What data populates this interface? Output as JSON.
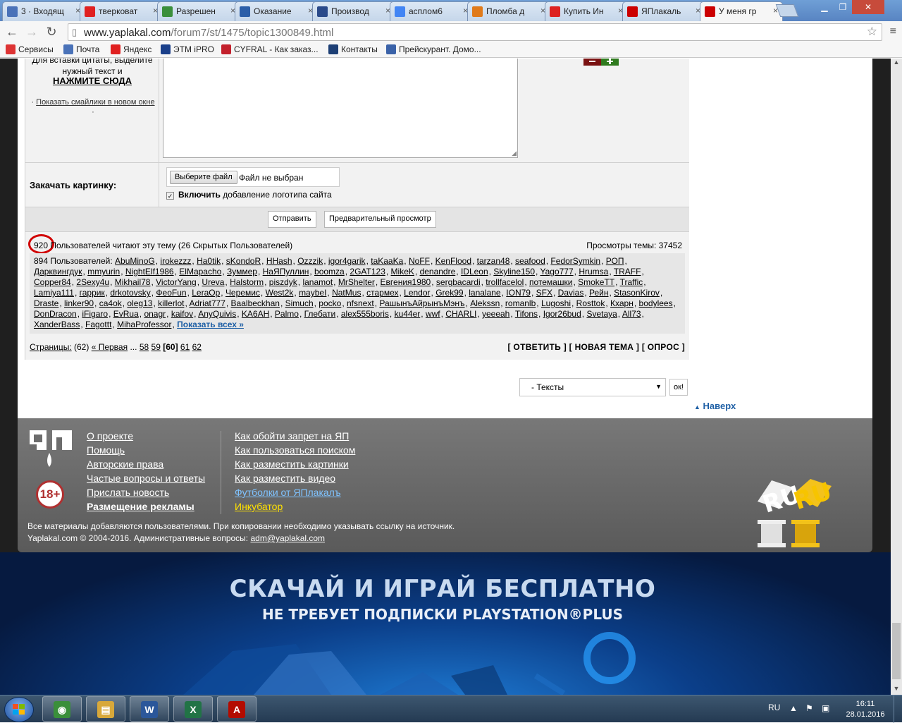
{
  "browser": {
    "tabs": [
      {
        "label": "3 · Входящ",
        "icon": "mail-icon",
        "color": "#4a72b8"
      },
      {
        "label": "тверковат",
        "icon": "yandex-icon",
        "color": "#e02020"
      },
      {
        "label": "Разрешен",
        "icon": "globe-icon",
        "color": "#3b8f3b"
      },
      {
        "label": "Оказание",
        "icon": "pin-icon",
        "color": "#2b5ea8"
      },
      {
        "label": "Производ",
        "icon": "site-icon",
        "color": "#2a4a8a"
      },
      {
        "label": "асплом6",
        "icon": "google-icon",
        "color": "#4285f4"
      },
      {
        "label": "Пломба д",
        "icon": "site-icon",
        "color": "#e07a1a"
      },
      {
        "label": "Купить Ин",
        "icon": "site-icon",
        "color": "#d22"
      },
      {
        "label": "ЯПлакаль",
        "icon": "yp-icon",
        "color": "#c00"
      },
      {
        "label": "У меня гр",
        "icon": "yp-icon",
        "color": "#c00",
        "active": true
      }
    ],
    "url_host": "www.yaplakal.com",
    "url_path": "/forum7/st/1475/topic1300849.html",
    "bookmarks": [
      {
        "label": "Сервисы",
        "icon": "apps-icon",
        "color": "#d33"
      },
      {
        "label": "Почта",
        "icon": "mail-icon",
        "color": "#4a72b8"
      },
      {
        "label": "Яндекс",
        "icon": "yandex-icon",
        "color": "#e02020"
      },
      {
        "label": "ЭТМ iPRO",
        "icon": "etm-icon",
        "color": "#1a3f8a"
      },
      {
        "label": "CYFRAL - Как заказ...",
        "icon": "cyfral-icon",
        "color": "#c3202c"
      },
      {
        "label": "Контакты",
        "icon": "contacts-icon",
        "color": "#1d3f75"
      },
      {
        "label": "Прейскурант. Домо...",
        "icon": "flag-icon",
        "color": "#3a62a8"
      }
    ]
  },
  "form": {
    "quote_hint": "Для вставки цитаты, выделите нужный текст и",
    "quote_click": "НАЖМИТЕ СЮДА",
    "smilies_link": "Показать смайлики в новом окне",
    "upload_label": "Закачать картинку:",
    "file_button": "Выберите файл",
    "file_status": "Файл не выбран",
    "logo_bold": "Включить",
    "logo_rest": "добавление логотипа сайта",
    "submit": "Отправить",
    "preview": "Предварительный просмотр"
  },
  "readers": {
    "count": "920",
    "text": "Пользователей читают эту тему (26 Скрытых Пользователей)",
    "views": "Просмотры темы: 37452",
    "users_prefix": "894 Пользователей:",
    "users": [
      "AbuMinoG",
      "irokezzz",
      "Ha0tik",
      "sKondoR",
      "HHash",
      "Ozzzik",
      "igor4garik",
      "taKaaKa",
      "NoFF",
      "KenFlood",
      "tarzan48",
      "seafood",
      "FedorSymkin",
      "РОП",
      "Дарквингдук",
      "mmyurin",
      "NightElf1986",
      "ElMapacho",
      "Зуммер",
      "НаЯПуллин",
      "boomza",
      "2GAT123",
      "MikeK",
      "denandre",
      "IDLeon",
      "Skyline150",
      "Yago777",
      "Hrumsa",
      "TRAFF",
      "Copper84",
      "2Sexy4u",
      "Mikhail78",
      "VictorYang",
      "Ureva",
      "Halstorm",
      "piszdyk",
      "lanamot",
      "MrShelter",
      "Евгения1980",
      "sergbacardi",
      "trollfacelol",
      "потемашки",
      "SmokeTT",
      "Traffic",
      "Lamiya111",
      "гаррик",
      "drkotovsky",
      "ФеоFun",
      "LeraOp",
      "Черемис",
      "West2k",
      "maybeI",
      "NatMus",
      "стармех",
      "Lendor",
      "Grek99",
      "lanalane",
      "ION79",
      "SFX",
      "Davias",
      "Рейн",
      "StasonKirov",
      "Draste",
      "linker90",
      "ca4ok",
      "oleg13",
      "killerlot",
      "Adriat777",
      "Baalbeckhan",
      "Simuch",
      "pocko",
      "nfsnext",
      "РашынъАйрынъМэнъ",
      "Alekssn",
      "romanlb",
      "Lugoshi",
      "Rosttok",
      "Кхарн",
      "bodylees",
      "DonDracon",
      "iFigaro",
      "EvRua",
      "onagr",
      "kaifov",
      "AnyQuivis",
      "KA6AH",
      "Palmo",
      "Глебати",
      "alex555boris",
      "ku44er",
      "wwf",
      "CHARLI",
      "yeeeah",
      "Tifons",
      "Igor26bud",
      "Svetaya",
      "All73",
      "XanderBass",
      "Fagottt",
      "MihaProfessor"
    ],
    "show_all": "Показать всех »"
  },
  "pager": {
    "label": "Страницы:",
    "total": "(62)",
    "first": "« Первая",
    "ellipsis": "...",
    "pages": [
      "58",
      "59"
    ],
    "current": "[60]",
    "after": [
      "61",
      "62"
    ],
    "actions": "[ ОТВЕТИТЬ ] [ НОВАЯ ТЕМА ] [ ОПРОС ]"
  },
  "jump": {
    "selected": "- Тексты",
    "ok": "ок!",
    "to_top": "Наверх"
  },
  "footer": {
    "col1": [
      "О проекте",
      "Помощь",
      "Авторские права",
      "Частые вопросы и ответы",
      "Прислать новость",
      "Размещение рекламы"
    ],
    "col2": [
      "Как обойти запрет на ЯП",
      "Как пользоваться поиском",
      "Как разместить картинки",
      "Как разместить видео",
      "Футболки от ЯПлакалъ",
      "Инкубатор"
    ],
    "col2_colors": [
      "#ffffff",
      "#ffffff",
      "#ffffff",
      "#ffffff",
      "#7fc3ff",
      "#ffe100"
    ],
    "age": "18+",
    "note1": "Все материалы добавляются пользователями. При копировании необходимо указывать ссылку на источник.",
    "note2_prefix": "Yaplakal.com © 2004-2016. Административные вопросы:",
    "email": "adm@yaplakal.com"
  },
  "ad": {
    "title": "СКАЧАЙ И ИГРАЙ БЕСПЛАТНО",
    "subtitle": "НЕ ТРЕБУЕТ ПОДПИСКИ PLAYSTATION®PLUS"
  },
  "taskbar": {
    "apps": [
      {
        "name": "chrome",
        "color": "#3a8f3a",
        "glyph": "◉"
      },
      {
        "name": "explorer",
        "color": "#d8a83a",
        "glyph": "▤"
      },
      {
        "name": "word",
        "color": "#2b579a",
        "glyph": "W"
      },
      {
        "name": "excel",
        "color": "#217346",
        "glyph": "X"
      },
      {
        "name": "acrobat",
        "color": "#b30b00",
        "glyph": "A"
      }
    ],
    "lang": "RU",
    "time": "16:11",
    "date": "28.01.2016"
  }
}
